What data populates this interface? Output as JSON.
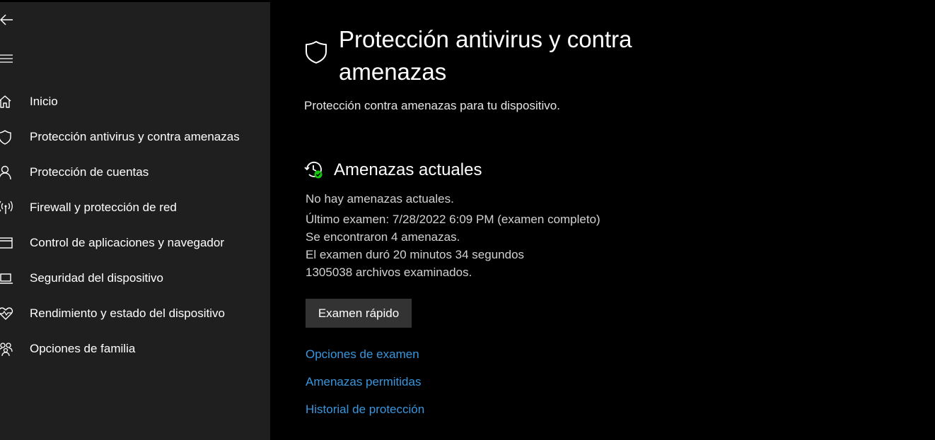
{
  "sidebar": {
    "back_icon": "back-arrow-icon",
    "menu_icon": "hamburger-menu-icon",
    "items": [
      {
        "label": "Inicio",
        "icon": "home-icon"
      },
      {
        "label": "Protección antivirus y contra amenazas",
        "icon": "shield-icon"
      },
      {
        "label": "Protección de cuentas",
        "icon": "person-icon"
      },
      {
        "label": "Firewall y protección de red",
        "icon": "wireless-antenna-icon"
      },
      {
        "label": "Control de aplicaciones y navegador",
        "icon": "browser-window-icon"
      },
      {
        "label": "Seguridad del dispositivo",
        "icon": "laptop-icon"
      },
      {
        "label": "Rendimiento y estado del dispositivo",
        "icon": "heart-pulse-icon"
      },
      {
        "label": "Opciones de familia",
        "icon": "family-icon"
      }
    ]
  },
  "main": {
    "title": "Protección antivirus y contra amenazas",
    "title_icon": "shield-icon",
    "subtitle": "Protección contra amenazas para tu dispositivo.",
    "section": {
      "title": "Amenazas actuales",
      "icon": "history-check-icon",
      "lines": [
        "No hay amenazas actuales.",
        "Último examen: 7/28/2022 6:09 PM (examen completo)",
        "Se encontraron 4 amenazas.",
        "El examen duró 20 minutos 34 segundos",
        "1305038 archivos examinados."
      ]
    },
    "quick_scan_label": "Examen rápido",
    "links": [
      "Opciones de examen",
      "Amenazas permitidas",
      "Historial de protección"
    ]
  },
  "colors": {
    "background": "#000000",
    "sidebar_background": "#1f1f1f",
    "link": "#3a96dd",
    "button_background": "#333333",
    "status_check": "#16c60c"
  }
}
